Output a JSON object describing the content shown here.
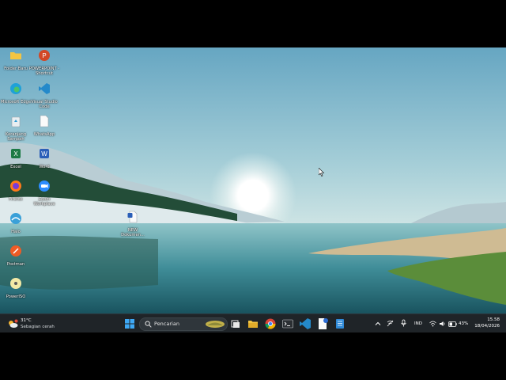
{
  "desktop": {
    "icons": [
      {
        "label": "Folder Baru",
        "icon": "folder-icon"
      },
      {
        "label": "POWERPOINT - Shortcut",
        "icon": "powerpoint-icon"
      },
      {
        "label": "Microsoft Edge",
        "icon": "edge-icon"
      },
      {
        "label": "Visual Studio Code",
        "icon": "vscode-icon"
      },
      {
        "label": "Keranjang Sampah",
        "icon": "recycle-bin-icon"
      },
      {
        "label": "WhatsApp",
        "icon": "whatsapp-icon"
      },
      {
        "label": "Excel",
        "icon": "excel-icon"
      },
      {
        "label": "Word",
        "icon": "word-icon"
      },
      {
        "label": "Firefox",
        "icon": "firefox-icon"
      },
      {
        "label": "Zoom Workplace",
        "icon": "zoom-icon"
      },
      {
        "label": "Halo",
        "icon": "halo-icon"
      },
      {
        "label": "Postman",
        "icon": "postman-icon"
      },
      {
        "label": "PowerISO",
        "icon": "poweriso-icon"
      },
      {
        "label": "NEW Dokumen...",
        "icon": "word-document-icon"
      }
    ]
  },
  "taskbar": {
    "weather": {
      "temp": "31°C",
      "condition": "Sebagian cerah"
    },
    "search_placeholder": "Pencarian",
    "language": "IND",
    "battery": "43%",
    "time": "15.58",
    "date": "18/04/2026"
  }
}
